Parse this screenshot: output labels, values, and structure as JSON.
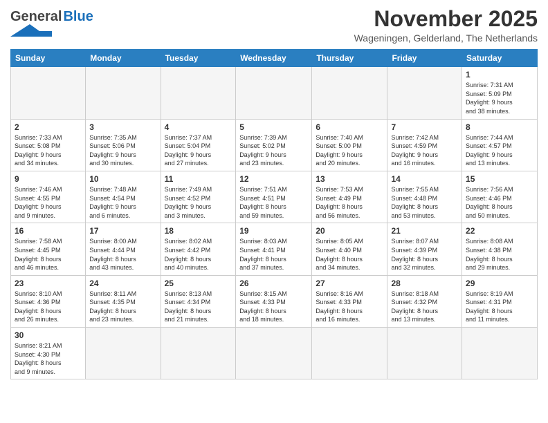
{
  "header": {
    "logo": {
      "general": "General",
      "blue": "Blue"
    },
    "month": "November 2025",
    "location": "Wageningen, Gelderland, The Netherlands"
  },
  "weekdays": [
    "Sunday",
    "Monday",
    "Tuesday",
    "Wednesday",
    "Thursday",
    "Friday",
    "Saturday"
  ],
  "weeks": [
    [
      {
        "day": "",
        "info": ""
      },
      {
        "day": "",
        "info": ""
      },
      {
        "day": "",
        "info": ""
      },
      {
        "day": "",
        "info": ""
      },
      {
        "day": "",
        "info": ""
      },
      {
        "day": "",
        "info": ""
      },
      {
        "day": "1",
        "info": "Sunrise: 7:31 AM\nSunset: 5:09 PM\nDaylight: 9 hours\nand 38 minutes."
      }
    ],
    [
      {
        "day": "2",
        "info": "Sunrise: 7:33 AM\nSunset: 5:08 PM\nDaylight: 9 hours\nand 34 minutes."
      },
      {
        "day": "3",
        "info": "Sunrise: 7:35 AM\nSunset: 5:06 PM\nDaylight: 9 hours\nand 30 minutes."
      },
      {
        "day": "4",
        "info": "Sunrise: 7:37 AM\nSunset: 5:04 PM\nDaylight: 9 hours\nand 27 minutes."
      },
      {
        "day": "5",
        "info": "Sunrise: 7:39 AM\nSunset: 5:02 PM\nDaylight: 9 hours\nand 23 minutes."
      },
      {
        "day": "6",
        "info": "Sunrise: 7:40 AM\nSunset: 5:00 PM\nDaylight: 9 hours\nand 20 minutes."
      },
      {
        "day": "7",
        "info": "Sunrise: 7:42 AM\nSunset: 4:59 PM\nDaylight: 9 hours\nand 16 minutes."
      },
      {
        "day": "8",
        "info": "Sunrise: 7:44 AM\nSunset: 4:57 PM\nDaylight: 9 hours\nand 13 minutes."
      }
    ],
    [
      {
        "day": "9",
        "info": "Sunrise: 7:46 AM\nSunset: 4:55 PM\nDaylight: 9 hours\nand 9 minutes."
      },
      {
        "day": "10",
        "info": "Sunrise: 7:48 AM\nSunset: 4:54 PM\nDaylight: 9 hours\nand 6 minutes."
      },
      {
        "day": "11",
        "info": "Sunrise: 7:49 AM\nSunset: 4:52 PM\nDaylight: 9 hours\nand 3 minutes."
      },
      {
        "day": "12",
        "info": "Sunrise: 7:51 AM\nSunset: 4:51 PM\nDaylight: 8 hours\nand 59 minutes."
      },
      {
        "day": "13",
        "info": "Sunrise: 7:53 AM\nSunset: 4:49 PM\nDaylight: 8 hours\nand 56 minutes."
      },
      {
        "day": "14",
        "info": "Sunrise: 7:55 AM\nSunset: 4:48 PM\nDaylight: 8 hours\nand 53 minutes."
      },
      {
        "day": "15",
        "info": "Sunrise: 7:56 AM\nSunset: 4:46 PM\nDaylight: 8 hours\nand 50 minutes."
      }
    ],
    [
      {
        "day": "16",
        "info": "Sunrise: 7:58 AM\nSunset: 4:45 PM\nDaylight: 8 hours\nand 46 minutes."
      },
      {
        "day": "17",
        "info": "Sunrise: 8:00 AM\nSunset: 4:44 PM\nDaylight: 8 hours\nand 43 minutes."
      },
      {
        "day": "18",
        "info": "Sunrise: 8:02 AM\nSunset: 4:42 PM\nDaylight: 8 hours\nand 40 minutes."
      },
      {
        "day": "19",
        "info": "Sunrise: 8:03 AM\nSunset: 4:41 PM\nDaylight: 8 hours\nand 37 minutes."
      },
      {
        "day": "20",
        "info": "Sunrise: 8:05 AM\nSunset: 4:40 PM\nDaylight: 8 hours\nand 34 minutes."
      },
      {
        "day": "21",
        "info": "Sunrise: 8:07 AM\nSunset: 4:39 PM\nDaylight: 8 hours\nand 32 minutes."
      },
      {
        "day": "22",
        "info": "Sunrise: 8:08 AM\nSunset: 4:38 PM\nDaylight: 8 hours\nand 29 minutes."
      }
    ],
    [
      {
        "day": "23",
        "info": "Sunrise: 8:10 AM\nSunset: 4:36 PM\nDaylight: 8 hours\nand 26 minutes."
      },
      {
        "day": "24",
        "info": "Sunrise: 8:11 AM\nSunset: 4:35 PM\nDaylight: 8 hours\nand 23 minutes."
      },
      {
        "day": "25",
        "info": "Sunrise: 8:13 AM\nSunset: 4:34 PM\nDaylight: 8 hours\nand 21 minutes."
      },
      {
        "day": "26",
        "info": "Sunrise: 8:15 AM\nSunset: 4:33 PM\nDaylight: 8 hours\nand 18 minutes."
      },
      {
        "day": "27",
        "info": "Sunrise: 8:16 AM\nSunset: 4:33 PM\nDaylight: 8 hours\nand 16 minutes."
      },
      {
        "day": "28",
        "info": "Sunrise: 8:18 AM\nSunset: 4:32 PM\nDaylight: 8 hours\nand 13 minutes."
      },
      {
        "day": "29",
        "info": "Sunrise: 8:19 AM\nSunset: 4:31 PM\nDaylight: 8 hours\nand 11 minutes."
      }
    ],
    [
      {
        "day": "30",
        "info": "Sunrise: 8:21 AM\nSunset: 4:30 PM\nDaylight: 8 hours\nand 9 minutes."
      },
      {
        "day": "",
        "info": ""
      },
      {
        "day": "",
        "info": ""
      },
      {
        "day": "",
        "info": ""
      },
      {
        "day": "",
        "info": ""
      },
      {
        "day": "",
        "info": ""
      },
      {
        "day": "",
        "info": ""
      }
    ]
  ]
}
